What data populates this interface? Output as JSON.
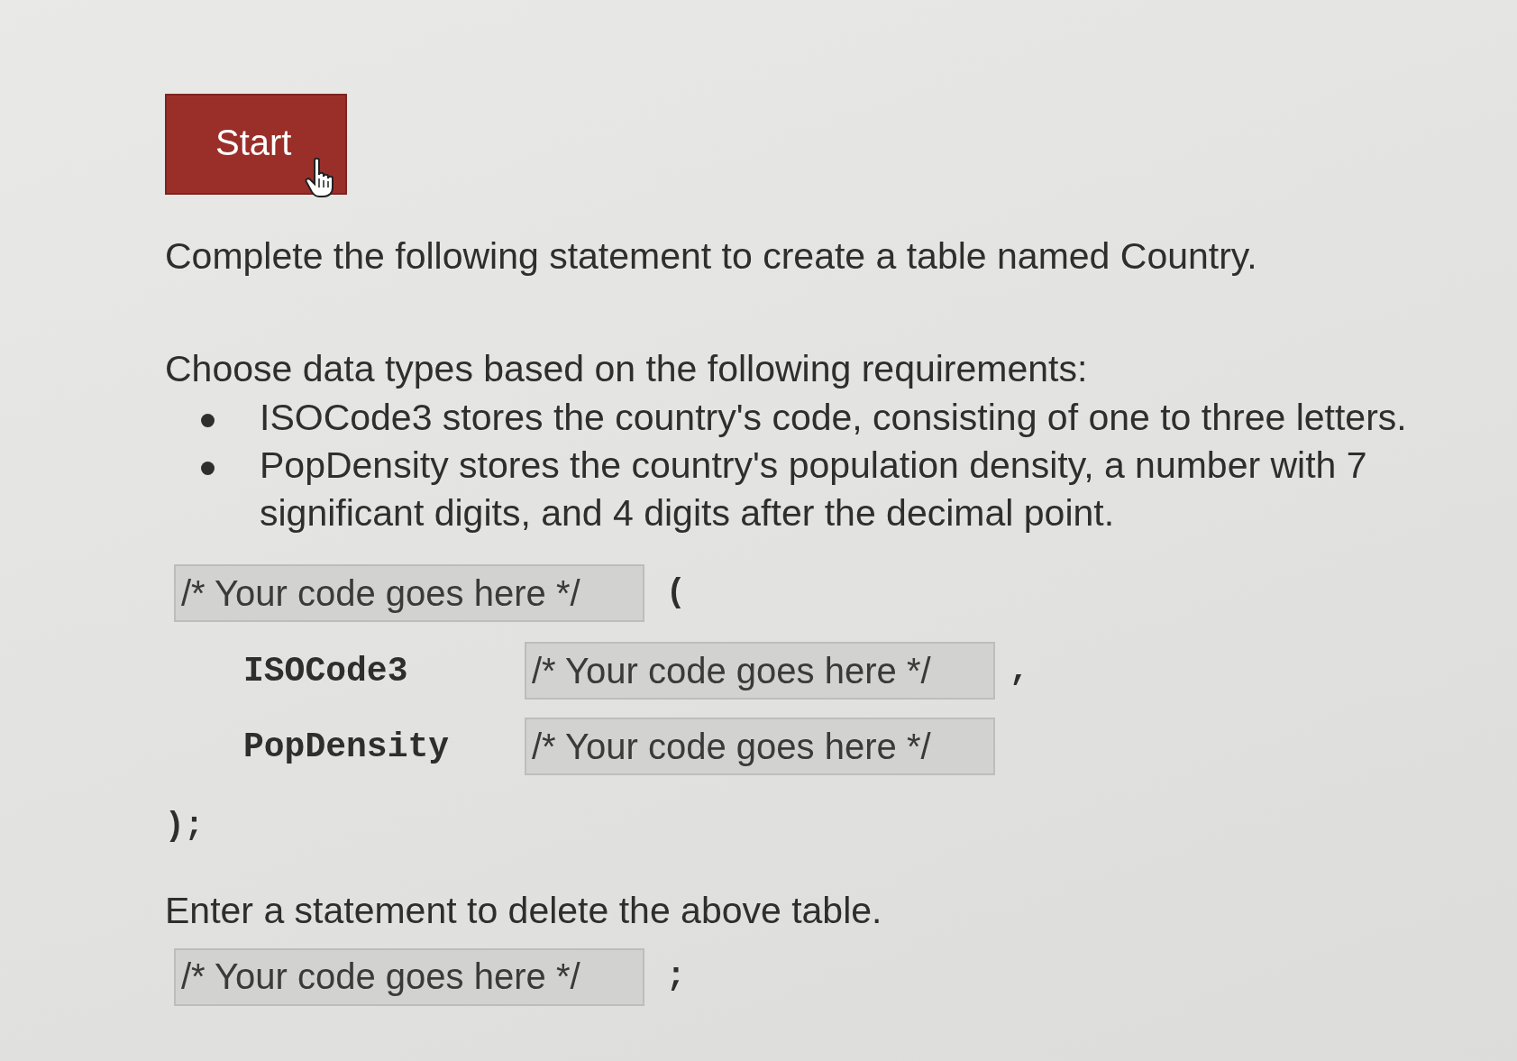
{
  "start_button": {
    "label": "Start"
  },
  "prompt": "Complete the following statement to create a table named Country.",
  "requirements_intro": "Choose data types based on the following requirements:",
  "requirements": [
    "ISOCode3 stores the country's code, consisting of one to three letters.",
    "PopDensity stores the country's population density, a number with 7 significant digits, and 4 digits after the decimal point."
  ],
  "create_statement": {
    "table_field": {
      "placeholder": "/* Your code goes here */"
    },
    "open_paren": "(",
    "columns": [
      {
        "name": "ISOCode3",
        "field": {
          "placeholder": "/* Your code goes here */"
        },
        "separator": ","
      },
      {
        "name": "PopDensity",
        "field": {
          "placeholder": "/* Your code goes here */"
        }
      }
    ],
    "close": ");"
  },
  "delete_prompt": "Enter a statement to delete the above table.",
  "delete_statement": {
    "field": {
      "placeholder": "/* Your code goes here */"
    },
    "terminator": ";"
  }
}
